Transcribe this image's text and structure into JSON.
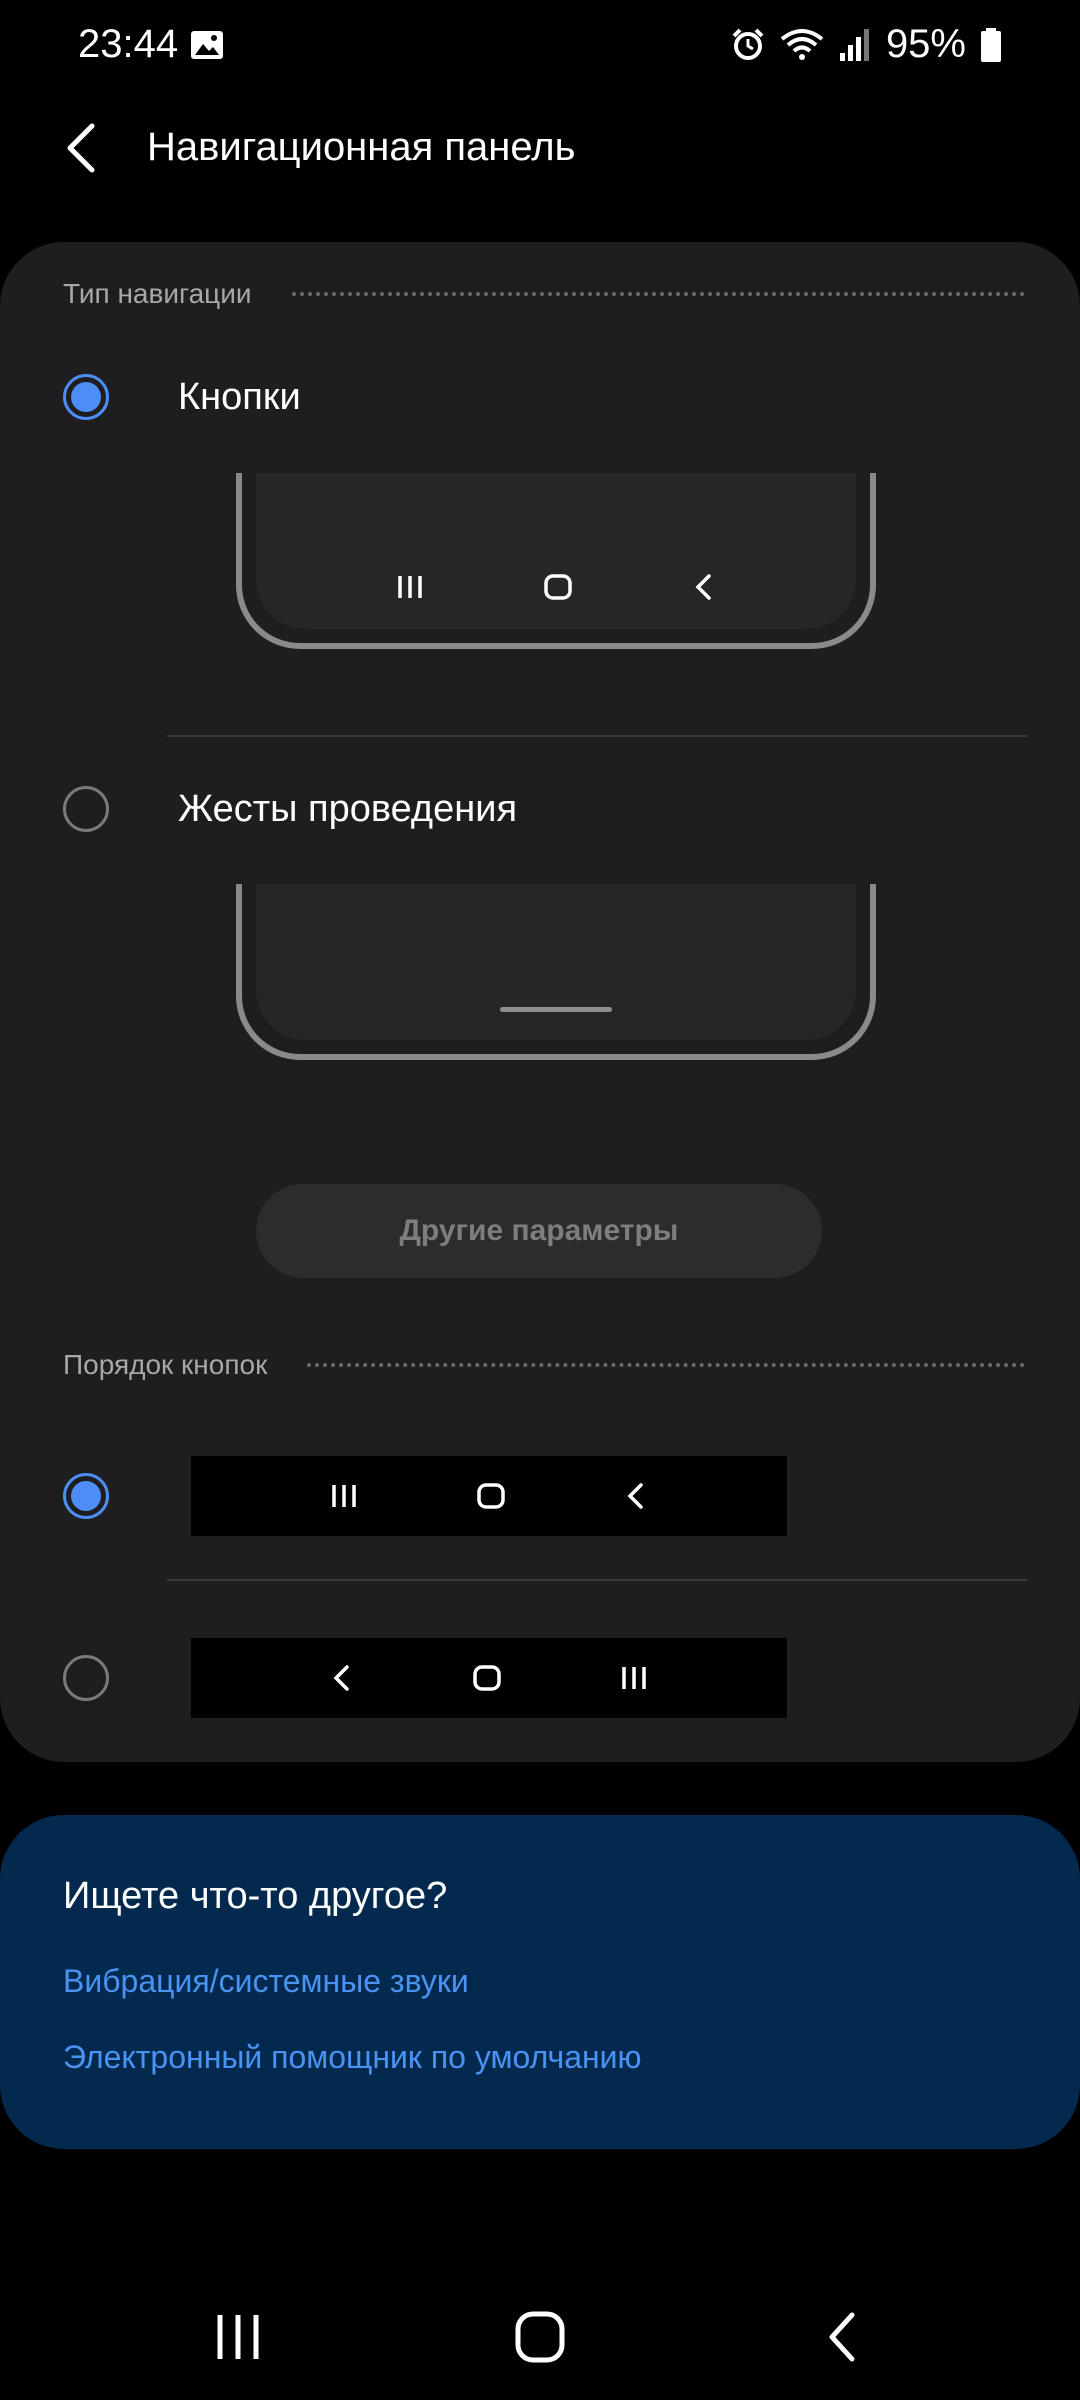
{
  "status_bar": {
    "time": "23:44",
    "battery": "95%",
    "icons": [
      "image-icon",
      "alarm-icon",
      "wifi-icon",
      "signal-icon",
      "battery-icon"
    ]
  },
  "header": {
    "title": "Навигационная панель"
  },
  "navigation_type": {
    "section_label": "Тип навигации",
    "options": [
      {
        "label": "Кнопки",
        "selected": true
      },
      {
        "label": "Жесты проведения",
        "selected": false
      }
    ],
    "more_button": "Другие параметры"
  },
  "button_order": {
    "section_label": "Порядок кнопок",
    "options": [
      {
        "selected": true,
        "icons": [
          "recents-icon",
          "home-icon",
          "back-icon"
        ]
      },
      {
        "selected": false,
        "icons": [
          "back-icon",
          "home-icon",
          "recents-icon"
        ]
      }
    ]
  },
  "suggestions": {
    "title": "Ищете что-то другое?",
    "links": [
      "Вибрация/системные звуки",
      "Электронный помощник по умолчанию"
    ]
  },
  "colors": {
    "accent": "#4c8ef5",
    "card": "#1e1e20",
    "suggest_card": "#032a4e",
    "link": "#4a93f2"
  }
}
